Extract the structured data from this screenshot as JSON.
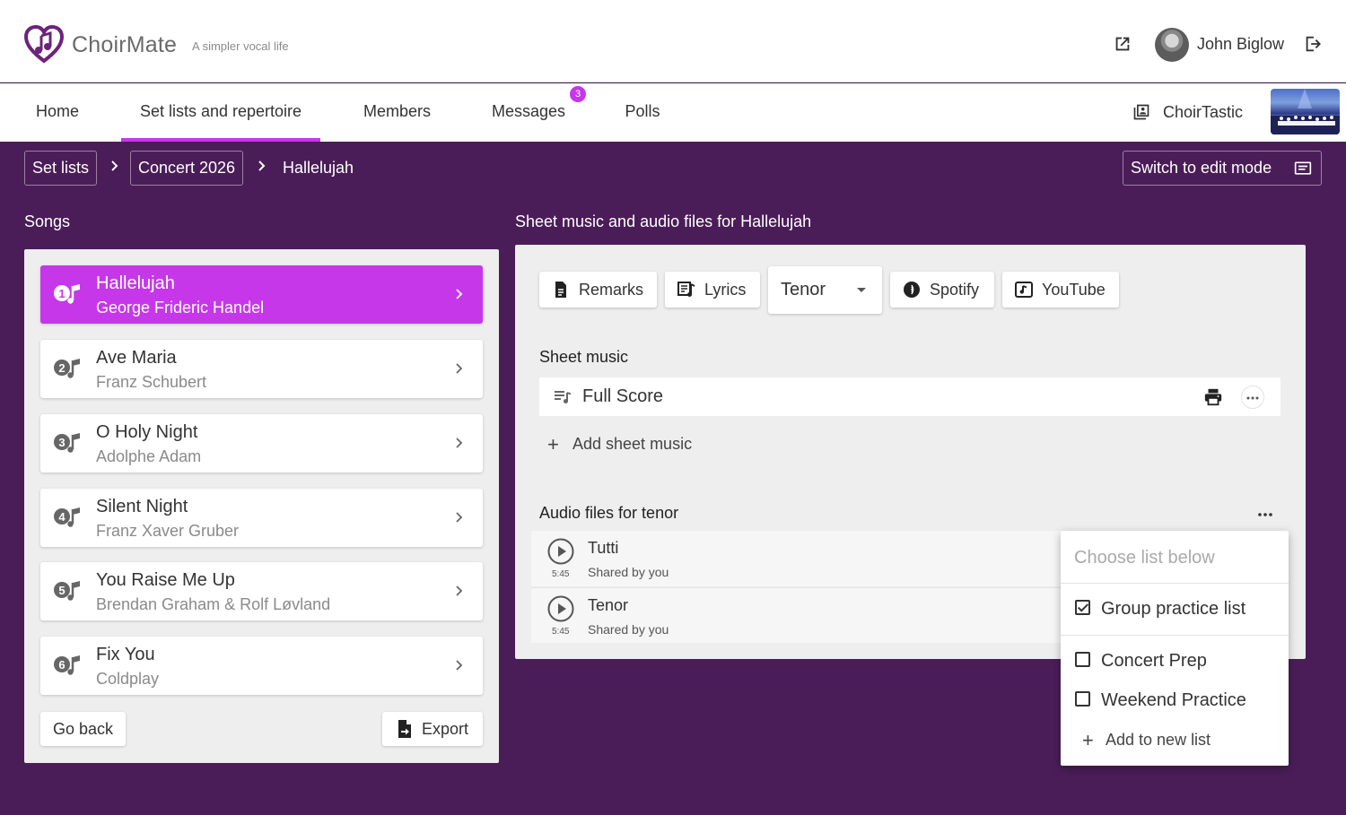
{
  "header": {
    "brand": "ChoirMate",
    "tagline": "A simpler vocal life",
    "user_name": "John Biglow"
  },
  "nav": {
    "items": [
      {
        "label": "Home"
      },
      {
        "label": "Set lists and repertoire",
        "active": true
      },
      {
        "label": "Members"
      },
      {
        "label": "Messages",
        "badge": "3"
      },
      {
        "label": "Polls"
      }
    ],
    "choir_name": "ChoirTastic"
  },
  "breadcrumb": {
    "items": [
      "Set lists",
      "Concert 2026"
    ],
    "current": "Hallelujah"
  },
  "edit_mode_label": "Switch to edit mode",
  "songs": {
    "title": "Songs",
    "items": [
      {
        "number": "1",
        "title": "Hallelujah",
        "artist": "George Frideric Handel",
        "active": true
      },
      {
        "number": "2",
        "title": "Ave Maria",
        "artist": "Franz Schubert"
      },
      {
        "number": "3",
        "title": "O Holy Night",
        "artist": "Adolphe Adam"
      },
      {
        "number": "4",
        "title": "Silent Night",
        "artist": "Franz Xaver Gruber"
      },
      {
        "number": "5",
        "title": "You Raise Me Up",
        "artist": "Brendan Graham & Rolf Løvland"
      },
      {
        "number": "6",
        "title": "Fix You",
        "artist": "Coldplay"
      }
    ],
    "go_back": "Go back",
    "export": "Export"
  },
  "details": {
    "title": "Sheet music and audio files for Hallelujah",
    "buttons": {
      "remarks": "Remarks",
      "lyrics": "Lyrics",
      "voice": "Tenor",
      "spotify": "Spotify",
      "youtube": "YouTube"
    },
    "sheet_music_title": "Sheet music",
    "sheet_items": [
      {
        "name": "Full Score"
      }
    ],
    "add_sheet": "Add sheet music",
    "audio_title": "Audio files for tenor",
    "audio_items": [
      {
        "title": "Tutti",
        "duration": "5:45",
        "shared": "Shared by you"
      },
      {
        "title": "Tenor",
        "duration": "5:45",
        "shared": "Shared by you"
      }
    ]
  },
  "menu": {
    "header": "Choose list below",
    "options": [
      {
        "label": "Group practice list",
        "checked": true
      },
      {
        "label": "Concert Prep",
        "checked": false
      },
      {
        "label": "Weekend Practice",
        "checked": false
      }
    ],
    "add_new": "Add to new list"
  },
  "colors": {
    "accent": "#c637ea",
    "background": "#4a1d58",
    "panel": "#eeeeee"
  }
}
